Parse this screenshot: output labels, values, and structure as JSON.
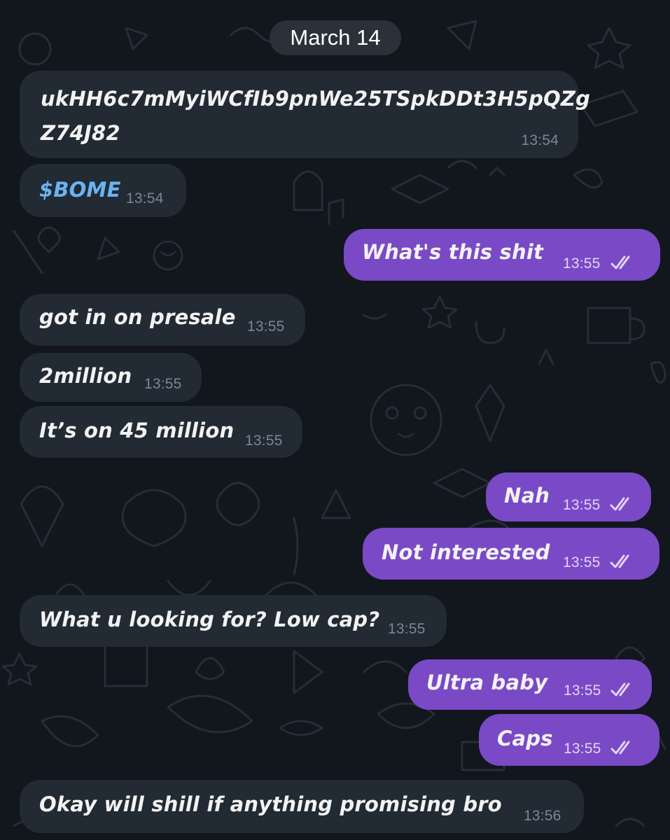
{
  "chat": {
    "date_label": "March 14",
    "colors": {
      "background": "#12161d",
      "incoming_bubble": "#222a33",
      "outgoing_bubble": "#7a49c6",
      "link": "#6ab3f3"
    },
    "messages": [
      {
        "direction": "incoming",
        "text_line1": "ukHH6c7mMyiWCfIb9pnWe25TSpkDDt3H5pQZg",
        "text_line2": "Z74J82",
        "time": "13:54"
      },
      {
        "direction": "incoming",
        "text": "$BOME",
        "time": "13:54",
        "is_link": true
      },
      {
        "direction": "outgoing",
        "text": "What's this shit",
        "time": "13:55",
        "status": "read",
        "status_icon": "double-check-icon"
      },
      {
        "direction": "incoming",
        "text": "got in on presale",
        "time": "13:55"
      },
      {
        "direction": "incoming",
        "text": "2million",
        "time": "13:55"
      },
      {
        "direction": "incoming",
        "text": "It’s on 45 million",
        "time": "13:55"
      },
      {
        "direction": "outgoing",
        "text": "Nah",
        "time": "13:55",
        "status": "read",
        "status_icon": "double-check-icon"
      },
      {
        "direction": "outgoing",
        "text": "Not interested",
        "time": "13:55",
        "status": "read",
        "status_icon": "double-check-icon"
      },
      {
        "direction": "incoming",
        "text": "What u looking for? Low cap?",
        "time": "13:55"
      },
      {
        "direction": "outgoing",
        "text": "Ultra baby",
        "time": "13:55",
        "status": "read",
        "status_icon": "double-check-icon"
      },
      {
        "direction": "outgoing",
        "text": "Caps",
        "time": "13:55",
        "status": "read",
        "status_icon": "double-check-icon"
      },
      {
        "direction": "incoming",
        "text": "Okay will shill if anything promising bro",
        "time": "13:56"
      }
    ]
  }
}
